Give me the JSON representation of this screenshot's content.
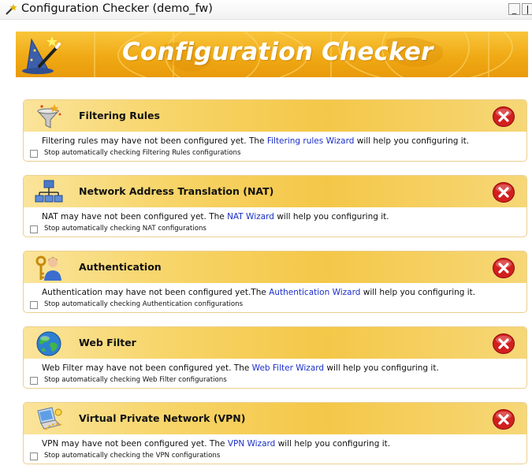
{
  "window": {
    "title": "Configuration Checker (demo_fw)",
    "minimize_glyph": "_",
    "maximize_glyph": "|"
  },
  "banner": {
    "title": "Configuration Checker",
    "icon": "wizard-hat-wand-icon"
  },
  "colors": {
    "banner_orange": "#f0aa15",
    "section_header_yellow": "#f7d467",
    "link_blue": "#1a2fc8",
    "close_red": "#d21f1f"
  },
  "sections": [
    {
      "title": "Filtering Rules",
      "icon": "funnel-sparkle-icon",
      "msg_before": "Filtering rules may have not been configured yet. The ",
      "link": "Filtering rules Wizard",
      "msg_after": " will help you configuring it.",
      "checkbox_label": "Stop automatically checking Filtering Rules configurations",
      "checked": false
    },
    {
      "title": "Network Address Translation (NAT)",
      "icon": "network-tree-icon",
      "msg_before": "NAT may have not been configured yet. The ",
      "link": "NAT Wizard",
      "msg_after": " will help you configuring it.",
      "checkbox_label": "Stop automatically checking NAT configurations",
      "checked": false
    },
    {
      "title": "Authentication",
      "icon": "key-user-icon",
      "msg_before": "Authentication may have not been configured yet.The ",
      "link": "Authentication Wizard",
      "msg_after": " will help you configuring it.",
      "checkbox_label": "Stop automatically checking Authentication configurations",
      "checked": false
    },
    {
      "title": "Web Filter",
      "icon": "globe-icon",
      "msg_before": "Web Filter may have not been configured yet. The ",
      "link": "Web Filter Wizard",
      "msg_after": " will help you configuring it.",
      "checkbox_label": "Stop automatically checking Web Filter configurations",
      "checked": false
    },
    {
      "title": "Virtual Private Network (VPN)",
      "icon": "vpn-laptop-icon",
      "msg_before": "VPN may have not been configured yet. The ",
      "link": "VPN Wizard",
      "msg_after": " will help you configuring it.",
      "checkbox_label": "Stop automatically checking the VPN configurations",
      "checked": false
    }
  ]
}
